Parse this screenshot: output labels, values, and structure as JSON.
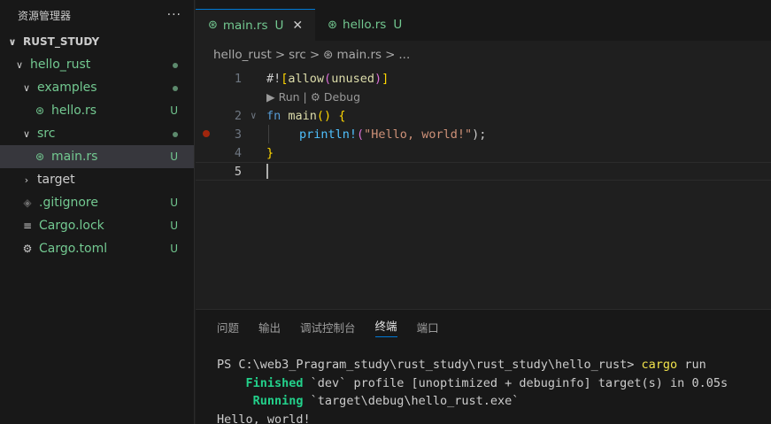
{
  "sidebar": {
    "title": "资源管理器",
    "more": "···",
    "root": "RUST_STUDY",
    "items": [
      {
        "label": "hello_rust",
        "status": ""
      },
      {
        "label": "examples",
        "status": ""
      },
      {
        "label": "hello.rs",
        "status": "U"
      },
      {
        "label": "src",
        "status": ""
      },
      {
        "label": "main.rs",
        "status": "U"
      },
      {
        "label": "target",
        "status": ""
      },
      {
        "label": ".gitignore",
        "status": "U"
      },
      {
        "label": "Cargo.lock",
        "status": "U"
      },
      {
        "label": "Cargo.toml",
        "status": "U"
      }
    ]
  },
  "tabs": [
    {
      "label": "main.rs",
      "status": "U",
      "close": "✕"
    },
    {
      "label": "hello.rs",
      "status": "U"
    }
  ],
  "breadcrumb": {
    "parts": [
      "hello_rust",
      "src",
      "main.rs",
      "..."
    ],
    "sep": ">"
  },
  "editor": {
    "lines": [
      {
        "num": "1",
        "tokens": [
          "#!",
          "[",
          "allow",
          "(",
          "unused",
          ")",
          "]"
        ]
      },
      {
        "lens": "▶ Run | ⚙ Debug"
      },
      {
        "num": "2",
        "tokens": [
          "fn",
          "main",
          "()",
          " {"
        ]
      },
      {
        "num": "3",
        "tokens": [
          "println!",
          "(",
          "\"Hello, world!\"",
          ");"
        ]
      },
      {
        "num": "4",
        "tokens": [
          "}"
        ]
      },
      {
        "num": "5",
        "tokens": []
      }
    ]
  },
  "panel": {
    "tabs": [
      "问题",
      "输出",
      "调试控制台",
      "终端",
      "端口"
    ],
    "active_tab": "终端",
    "terminal": {
      "prompt": "PS C:\\web3_Pragram_study\\rust_study\\rust_study\\hello_rust> ",
      "command": "cargo",
      "command_arg": " run",
      "finished_label": "Finished",
      "finished_text": " `dev` profile [unoptimized + debuginfo] target(s) in 0.05s",
      "running_label": "Running",
      "running_text": " `target\\debug\\hello_rust.exe`",
      "output": "Hello, world!"
    }
  },
  "colors": {
    "accent": "#0078d4",
    "git_untracked": "#73c991",
    "breakpoint": "#a1260d"
  }
}
